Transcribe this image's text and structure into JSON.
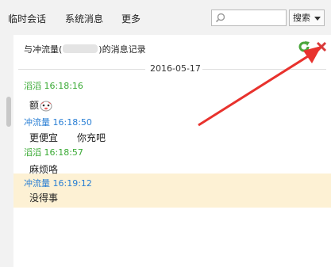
{
  "tabs": [
    {
      "label": "临时会话"
    },
    {
      "label": "系统消息"
    },
    {
      "label": "更多"
    }
  ],
  "search": {
    "placeholder": "",
    "button_label": "搜索"
  },
  "history": {
    "title_prefix": "与冲流量(",
    "title_suffix": ")的消息记录",
    "date": "2016-05-17",
    "messages": [
      {
        "sender": "滔滔",
        "time": "16:18:16",
        "text": "额",
        "sender_color": "#3aaa35"
      },
      {
        "sender": "冲流量",
        "time": "16:18:50",
        "text": "更便宜　　你充吧",
        "sender_color": "#2a7fd4"
      },
      {
        "sender": "滔滔",
        "time": "16:18:57",
        "text": "麻烦咯",
        "sender_color": "#3aaa35"
      },
      {
        "sender": "冲流量",
        "time": "16:19:12",
        "text": "没得事",
        "sender_color": "#2a7fd4"
      }
    ]
  },
  "colors": {
    "highlight": "#fdf1d4",
    "arrow": "#e8322d",
    "accent_green": "#3aaa35",
    "accent_blue": "#2a7fd4"
  },
  "icons": {
    "refresh": "refresh-icon",
    "close": "close-icon",
    "search": "search-icon",
    "emoji": "emoji-face-icon"
  }
}
